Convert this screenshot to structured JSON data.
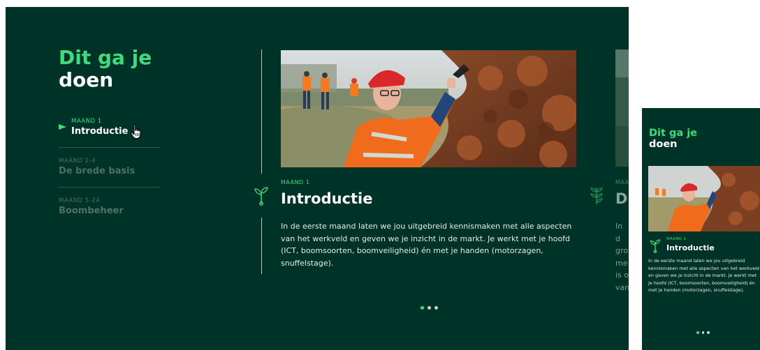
{
  "section": {
    "title_line1": "Dit ga je",
    "title_line2": "doen"
  },
  "nav": {
    "items": [
      {
        "month": "MAAND 1",
        "name": "Introductie"
      },
      {
        "month": "MAAND 2-4",
        "name": "De brede basis"
      },
      {
        "month": "MAAND 5-24",
        "name": "Boombeheer"
      }
    ]
  },
  "slides": [
    {
      "month": "MAAND 1",
      "title": "Introductie",
      "body": "In de eerste maand laten we jou uitgebreid kennismaken met alle aspecten van het werkveld en geven we je inzicht in de markt. Je werkt met je hoofd (ICT, boomsoorten, boomveiligheid) én met je handen (motorzagen, snuffelstage)."
    },
    {
      "month": "MAAN",
      "title": "D",
      "body_lines": [
        "In d",
        "gro",
        "me",
        "is o",
        "van"
      ]
    }
  ],
  "mobile": {
    "title_line1": "Dit ga je",
    "title_line2": "doen",
    "month": "MAAND 1",
    "slide_title": "Introductie",
    "body": "In de eerste maand laten we jou uitgebreid kennismaken met alle aspecten van het werkveld en geven we je inzicht in de markt. Je werkt met je hoofd (ICT, boomsoorten, boomveiligheid) én met je handen (motorzagen, snuffelstage)."
  },
  "carousel": {
    "count": 3,
    "active": 1
  },
  "colors": {
    "background": "#003327",
    "accent": "#3fdc7e",
    "text": "#ffffff",
    "muted": "#4f6f66"
  },
  "icons": [
    "sprout-icon",
    "sprout-leaves-icon",
    "arrow-right-icon",
    "hand-pointer-icon"
  ]
}
